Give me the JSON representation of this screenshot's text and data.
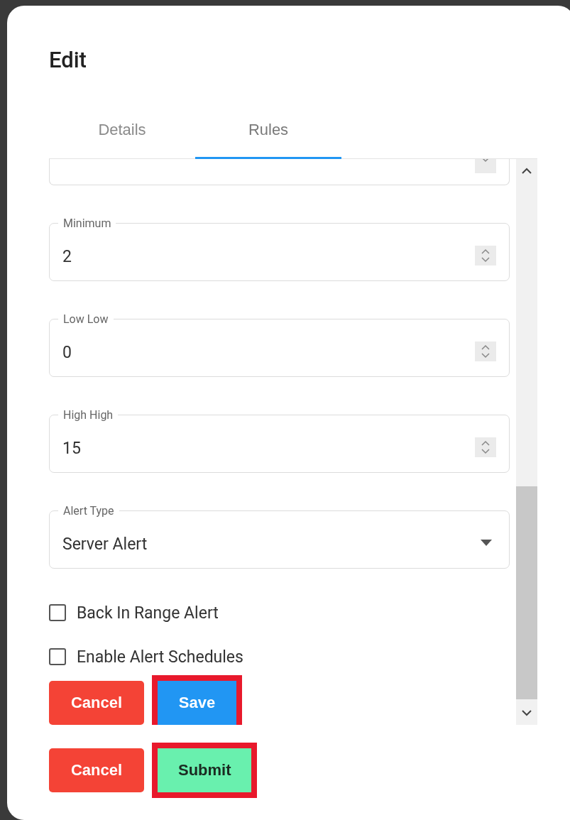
{
  "dialog": {
    "title": "Edit"
  },
  "tabs": [
    {
      "label": "Details",
      "selected": false
    },
    {
      "label": "Rules",
      "selected": true
    }
  ],
  "form": {
    "fields": [
      {
        "kind": "clipped"
      },
      {
        "kind": "number",
        "label": "Minimum",
        "value": "2"
      },
      {
        "kind": "number",
        "label": "Low Low",
        "value": "0"
      },
      {
        "kind": "number",
        "label": "High High",
        "value": "15"
      },
      {
        "kind": "select",
        "label": "Alert Type",
        "value": "Server Alert"
      }
    ],
    "checkboxes": [
      {
        "label": "Back In Range Alert",
        "checked": false
      },
      {
        "label": "Enable Alert Schedules",
        "checked": false
      }
    ],
    "buttons": [
      {
        "label": "Cancel",
        "kind": "cancel",
        "highlighted": false
      },
      {
        "label": "Save",
        "kind": "save",
        "highlighted": true
      }
    ]
  },
  "footer": {
    "buttons": [
      {
        "label": "Cancel",
        "kind": "cancel",
        "highlighted": false
      },
      {
        "label": "Submit",
        "kind": "submit",
        "highlighted": true
      }
    ]
  }
}
